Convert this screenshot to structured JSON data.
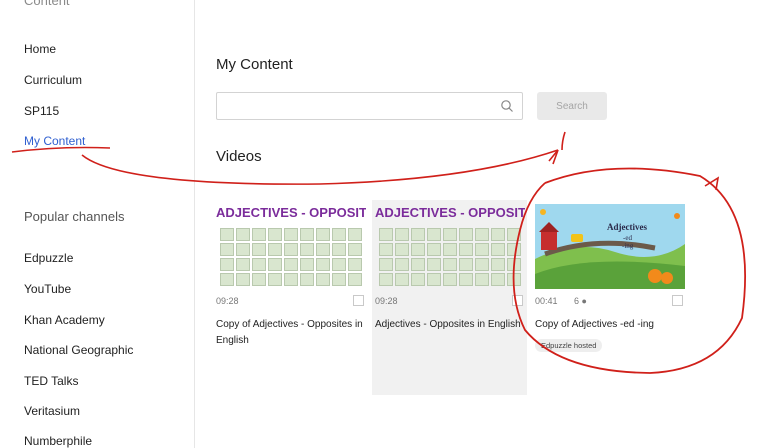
{
  "sidebar": {
    "section_head": "Content",
    "items": [
      {
        "label": "Home"
      },
      {
        "label": "Curriculum"
      },
      {
        "label": "SP115"
      },
      {
        "label": "My Content"
      }
    ],
    "channels_title": "Popular channels",
    "channels": [
      {
        "label": "Edpuzzle"
      },
      {
        "label": "YouTube"
      },
      {
        "label": "Khan Academy"
      },
      {
        "label": "National Geographic"
      },
      {
        "label": "TED Talks"
      },
      {
        "label": "Veritasium"
      },
      {
        "label": "Numberphile"
      }
    ]
  },
  "main": {
    "title": "My Content",
    "search": {
      "placeholder": "",
      "button_label": "Search"
    },
    "videos_title": "Videos",
    "videos": [
      {
        "thumb_title": "ADJECTIVES - OPPOSITES",
        "duration": "09:28",
        "extra": "",
        "title": "Copy of Adjectives - Opposites in English",
        "badge": ""
      },
      {
        "thumb_title": "ADJECTIVES - OPPOSITES",
        "duration": "09:28",
        "extra": "",
        "title": "Adjectives - Opposites in English",
        "badge": ""
      },
      {
        "thumb_title": "Adjectives",
        "thumb_line1": "-ed",
        "thumb_line2": "-ing",
        "duration": "00:41",
        "extra": "6 ●",
        "title": "Copy of Adjectives -ed -ing",
        "badge": "Edpuzzle hosted"
      }
    ]
  },
  "colors": {
    "accent": "#2f5fd0",
    "annotation": "#d0201a"
  }
}
